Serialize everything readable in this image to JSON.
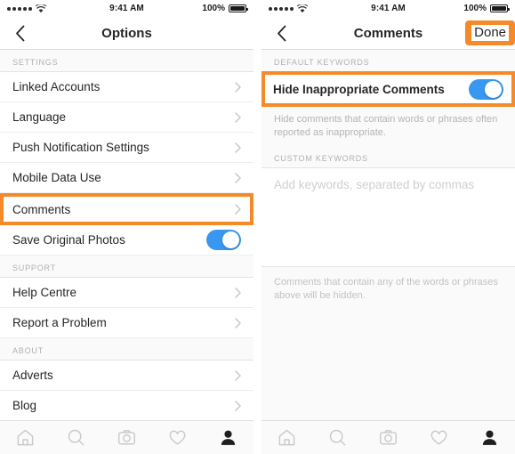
{
  "statusbar": {
    "signal_icon": "signal-dots-icon",
    "wifi_icon": "wifi-icon",
    "time": "9:41 AM",
    "battery_percent": "100%",
    "battery_icon": "battery-full-icon"
  },
  "annotation_color": "#f58a28",
  "accent_color": "#3897f0",
  "left_screen": {
    "nav": {
      "back_icon": "chevron-left-icon",
      "title": "Options"
    },
    "sections": [
      {
        "header": "SETTINGS",
        "rows": [
          {
            "label": "Linked Accounts",
            "type": "chevron",
            "highlighted": false
          },
          {
            "label": "Language",
            "type": "chevron",
            "highlighted": false
          },
          {
            "label": "Push Notification Settings",
            "type": "chevron",
            "highlighted": false
          },
          {
            "label": "Mobile Data Use",
            "type": "chevron",
            "highlighted": false
          },
          {
            "label": "Comments",
            "type": "chevron",
            "highlighted": true
          },
          {
            "label": "Save Original Photos",
            "type": "toggle",
            "toggle_on": true,
            "highlighted": false
          }
        ]
      },
      {
        "header": "SUPPORT",
        "rows": [
          {
            "label": "Help Centre",
            "type": "chevron",
            "highlighted": false
          },
          {
            "label": "Report a Problem",
            "type": "chevron",
            "highlighted": false
          }
        ]
      },
      {
        "header": "ABOUT",
        "rows": [
          {
            "label": "Adverts",
            "type": "chevron",
            "highlighted": false
          },
          {
            "label": "Blog",
            "type": "chevron",
            "highlighted": false
          }
        ]
      }
    ]
  },
  "right_screen": {
    "nav": {
      "back_icon": "chevron-left-icon",
      "title": "Comments",
      "done_label": "Done",
      "done_highlighted": true
    },
    "default_keywords": {
      "header": "DEFAULT KEYWORDS",
      "row_label": "Hide Inappropriate Comments",
      "toggle_on": true,
      "highlighted": true,
      "helper_text": "Hide comments that contain words or phrases often reported as inappropriate."
    },
    "custom_keywords": {
      "header": "CUSTOM KEYWORDS",
      "placeholder": "Add keywords, separated by commas",
      "value": "",
      "footer_note": "Comments that contain any of the words or phrases above will be hidden."
    }
  },
  "tabbar": {
    "tabs": [
      {
        "icon": "home-icon",
        "active": false
      },
      {
        "icon": "search-icon",
        "active": false
      },
      {
        "icon": "camera-icon",
        "active": false
      },
      {
        "icon": "heart-icon",
        "active": false
      },
      {
        "icon": "profile-icon",
        "active": true
      }
    ]
  }
}
